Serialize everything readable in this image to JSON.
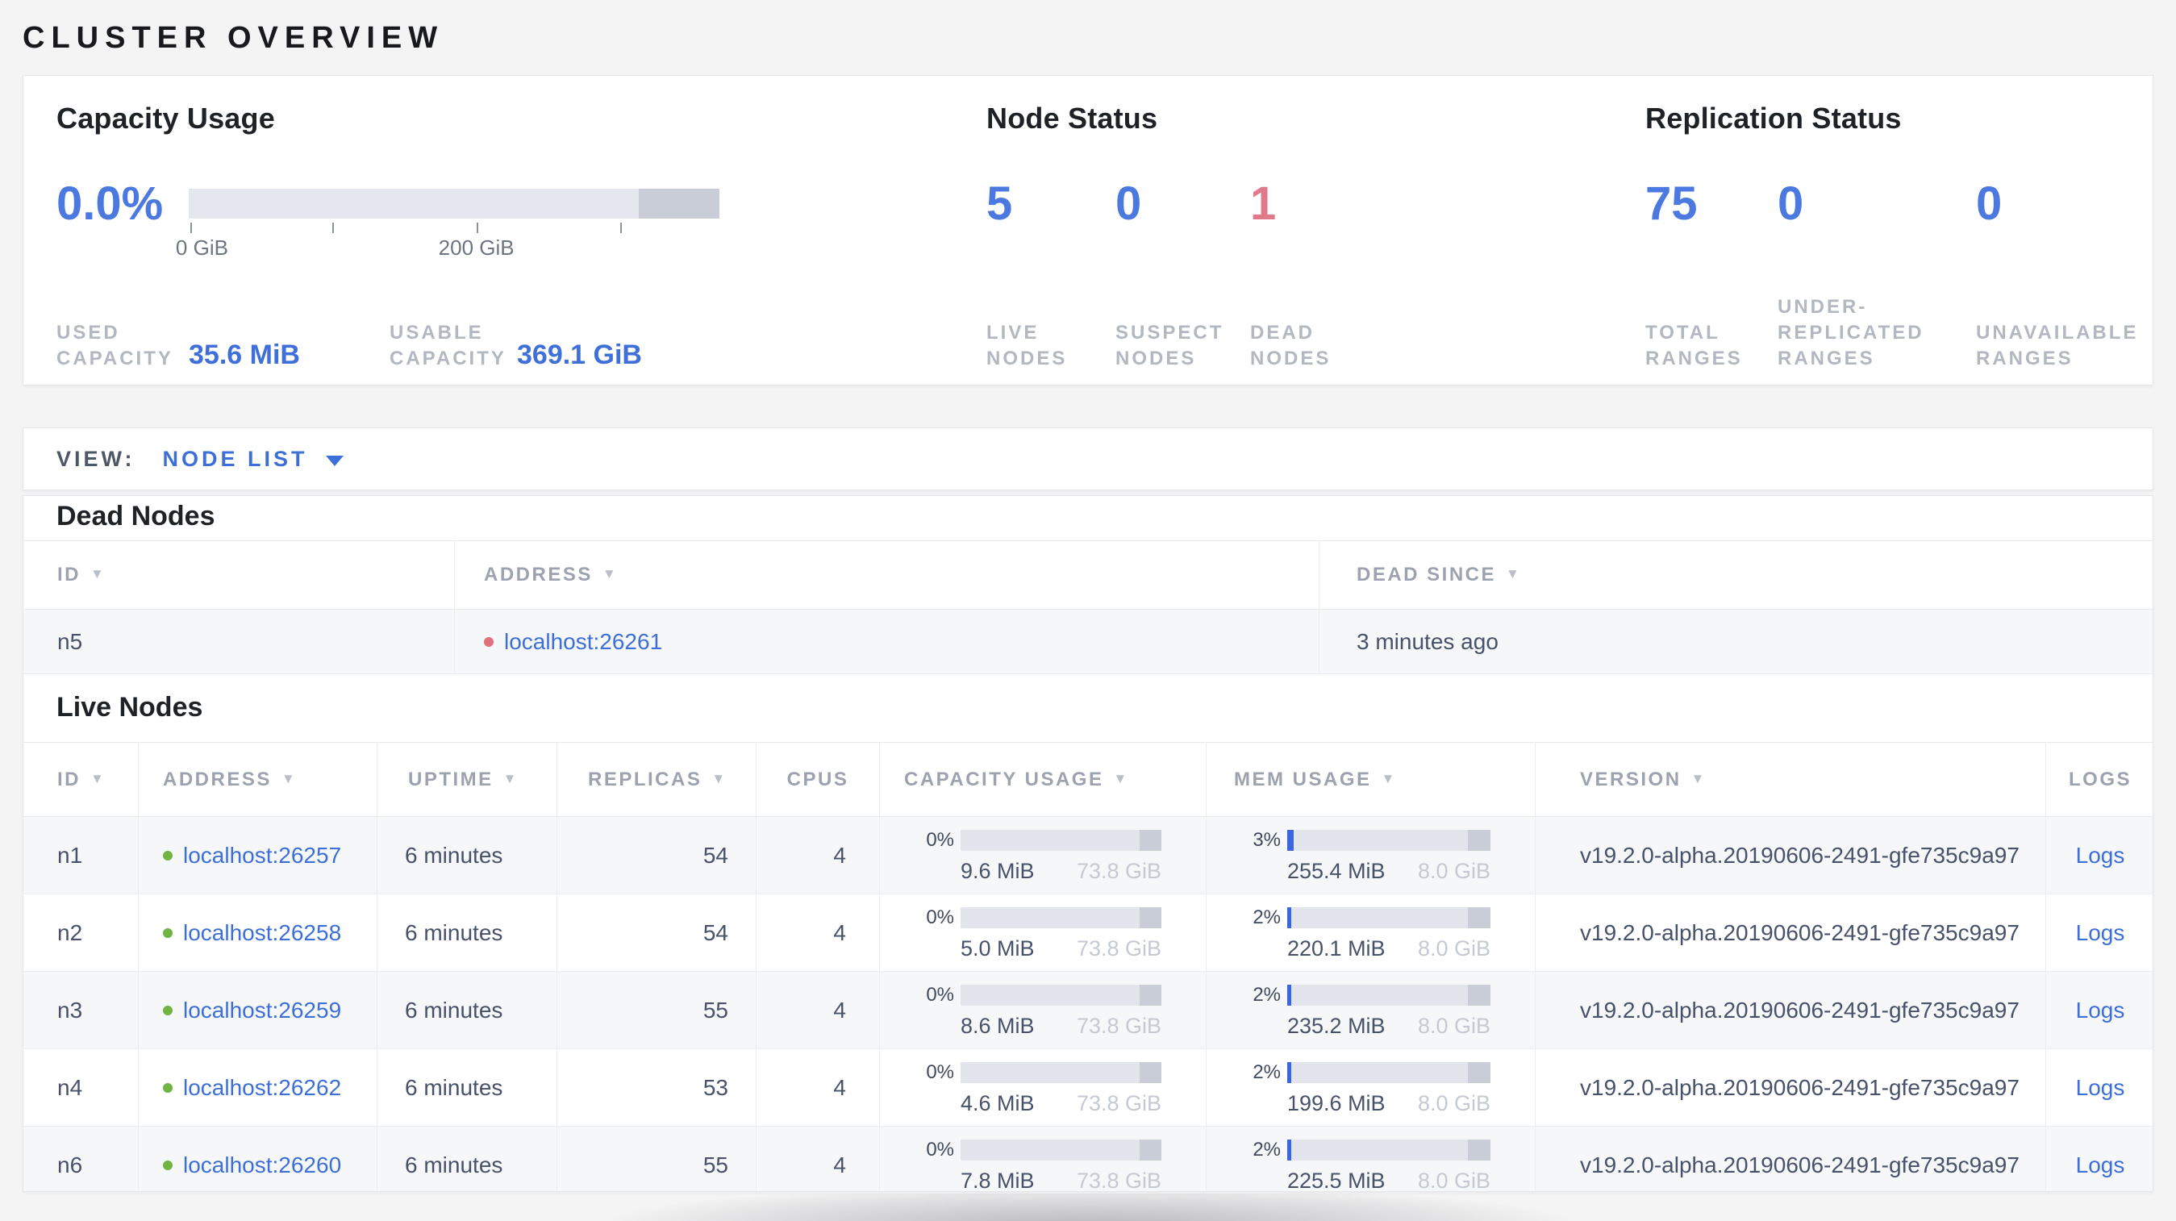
{
  "page": {
    "title": "CLUSTER OVERVIEW"
  },
  "colors": {
    "accent_blue": "#4b79e0",
    "link_blue": "#3d6fd8",
    "danger_red": "#e1798a",
    "healthy_green": "#70b544",
    "bar_track": "#e2e5ec",
    "bar_endcap": "#c9cdd8",
    "bar_fill_blue": "#3c66dd"
  },
  "overview": {
    "capacity": {
      "title": "Capacity Usage",
      "percent": "0.0%",
      "axis_ticks": [
        {
          "label": "0 GiB",
          "pos_pct": 0.3
        },
        {
          "label": "",
          "pos_pct": 27.1
        },
        {
          "label": "200 GiB",
          "pos_pct": 54.2
        },
        {
          "label": "",
          "pos_pct": 81.3
        }
      ],
      "used_label": "USED CAPACITY",
      "used_value": "35.6 MiB",
      "usable_label": "USABLE CAPACITY",
      "usable_value": "369.1 GiB"
    },
    "node_status": {
      "title": "Node Status",
      "live": {
        "value": "5",
        "label": "LIVE NODES"
      },
      "suspect": {
        "value": "0",
        "label": "SUSPECT NODES"
      },
      "dead": {
        "value": "1",
        "label": "DEAD NODES"
      }
    },
    "replication": {
      "title": "Replication Status",
      "total": {
        "value": "75",
        "label": "TOTAL RANGES"
      },
      "under": {
        "value": "0",
        "label": "UNDER-REPLICATED RANGES"
      },
      "unavailable": {
        "value": "0",
        "label": "UNAVAILABLE RANGES"
      }
    }
  },
  "view_bar": {
    "label": "VIEW:",
    "selected": "NODE LIST"
  },
  "dead_nodes": {
    "title": "Dead Nodes",
    "columns": {
      "id": "ID",
      "address": "ADDRESS",
      "dead_since": "DEAD SINCE"
    },
    "rows": [
      {
        "id": "n5",
        "address": "localhost:26261",
        "dead_since": "3 minutes ago"
      }
    ]
  },
  "live_nodes": {
    "title": "Live Nodes",
    "columns": {
      "id": "ID",
      "address": "ADDRESS",
      "uptime": "UPTIME",
      "replicas": "REPLICAS",
      "cpus": "CPUS",
      "capacity_usage": "CAPACITY USAGE",
      "mem_usage": "MEM USAGE",
      "version": "VERSION",
      "logs": "LOGS"
    },
    "rows": [
      {
        "id": "n1",
        "address": "localhost:26257",
        "uptime": "6 minutes",
        "replicas": "54",
        "cpus": "4",
        "cap_pct": "0%",
        "cap_fill": 0,
        "cap_used": "9.6 MiB",
        "cap_max": "73.8 GiB",
        "mem_pct": "3%",
        "mem_fill": 3,
        "mem_used": "255.4 MiB",
        "mem_max": "8.0 GiB",
        "version": "v19.2.0-alpha.20190606-2491-gfe735c9a97",
        "logs": "Logs"
      },
      {
        "id": "n2",
        "address": "localhost:26258",
        "uptime": "6 minutes",
        "replicas": "54",
        "cpus": "4",
        "cap_pct": "0%",
        "cap_fill": 0,
        "cap_used": "5.0 MiB",
        "cap_max": "73.8 GiB",
        "mem_pct": "2%",
        "mem_fill": 2,
        "mem_used": "220.1 MiB",
        "mem_max": "8.0 GiB",
        "version": "v19.2.0-alpha.20190606-2491-gfe735c9a97",
        "logs": "Logs"
      },
      {
        "id": "n3",
        "address": "localhost:26259",
        "uptime": "6 minutes",
        "replicas": "55",
        "cpus": "4",
        "cap_pct": "0%",
        "cap_fill": 0,
        "cap_used": "8.6 MiB",
        "cap_max": "73.8 GiB",
        "mem_pct": "2%",
        "mem_fill": 2,
        "mem_used": "235.2 MiB",
        "mem_max": "8.0 GiB",
        "version": "v19.2.0-alpha.20190606-2491-gfe735c9a97",
        "logs": "Logs"
      },
      {
        "id": "n4",
        "address": "localhost:26262",
        "uptime": "6 minutes",
        "replicas": "53",
        "cpus": "4",
        "cap_pct": "0%",
        "cap_fill": 0,
        "cap_used": "4.6 MiB",
        "cap_max": "73.8 GiB",
        "mem_pct": "2%",
        "mem_fill": 2,
        "mem_used": "199.6 MiB",
        "mem_max": "8.0 GiB",
        "version": "v19.2.0-alpha.20190606-2491-gfe735c9a97",
        "logs": "Logs"
      },
      {
        "id": "n6",
        "address": "localhost:26260",
        "uptime": "6 minutes",
        "replicas": "55",
        "cpus": "4",
        "cap_pct": "0%",
        "cap_fill": 0,
        "cap_used": "7.8 MiB",
        "cap_max": "73.8 GiB",
        "mem_pct": "2%",
        "mem_fill": 2,
        "mem_used": "225.5 MiB",
        "mem_max": "8.0 GiB",
        "version": "v19.2.0-alpha.20190606-2491-gfe735c9a97",
        "logs": "Logs"
      }
    ]
  }
}
